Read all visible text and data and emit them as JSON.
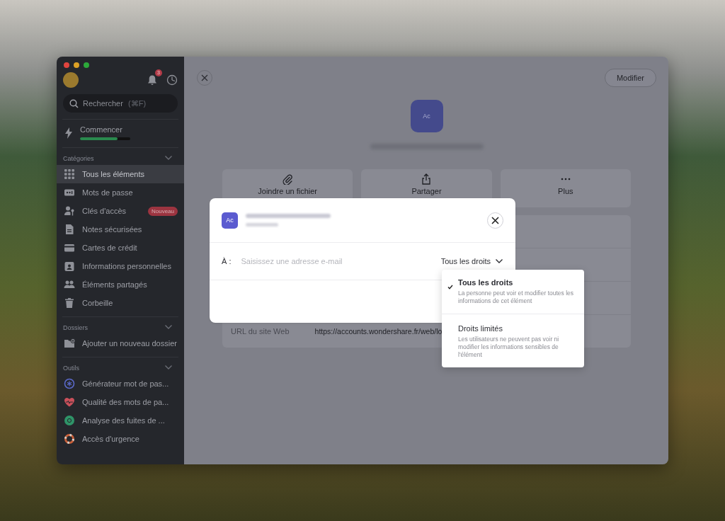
{
  "sidebar": {
    "notification_count": "3",
    "search": {
      "placeholder": "Rechercher",
      "shortcut": "(⌘F)"
    },
    "getting_started": {
      "label": "Commencer",
      "level": 0.74
    },
    "sections": [
      {
        "title": "Catégories",
        "expanded": true,
        "items": [
          {
            "label": "Tous les éléments",
            "kind": "grid",
            "selected": true
          },
          {
            "label": "Mots de passe",
            "kind": "password",
            "selected": false
          },
          {
            "label": "Clés d'accès",
            "kind": "passkey",
            "selected": false,
            "badge": "Nouveau"
          },
          {
            "label": "Notes sécurisées",
            "kind": "note",
            "selected": false
          },
          {
            "label": "Cartes de crédit",
            "kind": "card",
            "selected": false
          },
          {
            "label": "Informations personnelles",
            "kind": "id",
            "selected": false
          },
          {
            "label": "Éléments partagés",
            "kind": "people",
            "selected": false
          },
          {
            "label": "Corbeille",
            "kind": "trash",
            "selected": false
          }
        ]
      },
      {
        "title": "Dossiers",
        "expanded": true,
        "items": [
          {
            "label": "Ajouter un nouveau dossier",
            "kind": "folder-add",
            "selected": false
          }
        ]
      },
      {
        "title": "Outils",
        "expanded": true,
        "items": [
          {
            "label": "Générateur mot de pas...",
            "kind": "generator",
            "selected": false
          },
          {
            "label": "Qualité des mots de pa...",
            "kind": "heart",
            "selected": false
          },
          {
            "label": "Analyse des fuites de ...",
            "kind": "leak",
            "selected": false
          },
          {
            "label": "Accès d'urgence",
            "kind": "lifebuoy",
            "selected": false
          }
        ]
      }
    ]
  },
  "detail": {
    "edit_button": "Modifier",
    "avatar": "Ac",
    "actions": [
      {
        "label": "Joindre un fichier",
        "kind": "paperclip"
      },
      {
        "label": "Partager",
        "kind": "share"
      },
      {
        "label": "Plus",
        "kind": "more"
      }
    ],
    "fields": [
      {
        "label": "URL du site Web",
        "value": "https://accounts.wondershare.fr/web/lo"
      }
    ]
  },
  "share_dialog": {
    "avatar": "Ac",
    "to_label": "À :",
    "email": {
      "placeholder": "Saisissez une adresse e-mail"
    },
    "rights": "Tous les droits",
    "menu": [
      {
        "title": "Tous les droits",
        "description": "La personne peut voir et modifier toutes les informations de cet élément",
        "selected": true
      },
      {
        "title": "Droits limités",
        "description": "Les utilisateurs ne peuvent pas voir ni modifier les informations sensibles de l'élément",
        "selected": false
      }
    ]
  }
}
